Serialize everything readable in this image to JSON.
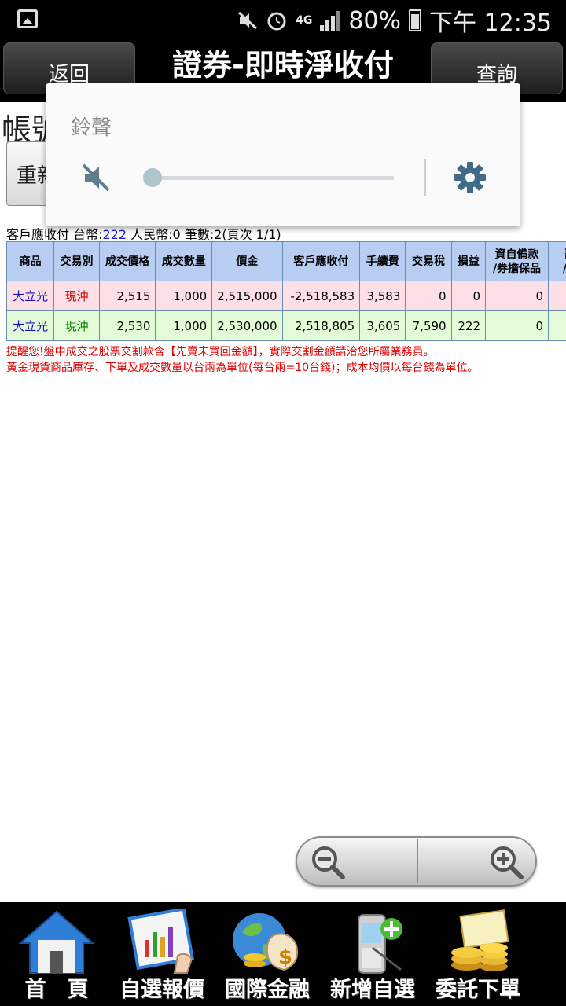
{
  "status_bar": {
    "network": "4G",
    "battery": "80%",
    "time": "下午 12:35"
  },
  "header": {
    "back_label": "返回",
    "title": "證券-即時淨收付",
    "query_label": "查詢"
  },
  "background": {
    "account_label": "帳號",
    "refresh_label": "重新"
  },
  "volume_popup": {
    "title": "鈴聲",
    "level": 0
  },
  "summary": {
    "prefix": "客戶應收付 台幣:",
    "twd": "222",
    "rmb_text": " 人民幣:0 筆數:2(頁次 1/1)"
  },
  "table": {
    "headers": [
      "商品",
      "交易別",
      "成交價格",
      "成交數量",
      "價金",
      "客戶應收付",
      "手續費",
      "交易稅",
      "損益",
      "資自備款\n/券擔保品",
      "融資\n/券保"
    ],
    "rows": [
      [
        "大立光",
        "現沖",
        "2,515",
        "1,000",
        "2,515,000",
        "-2,518,583",
        "3,583",
        "0",
        "0",
        "0",
        ""
      ],
      [
        "大立光",
        "現沖",
        "2,530",
        "1,000",
        "2,530,000",
        "2,518,805",
        "3,605",
        "7,590",
        "222",
        "0",
        ""
      ]
    ]
  },
  "notes": [
    "提醒您!盤中成交之股票交割款含【先賣未買回金額】，實際交割金額請洽您所屬業務員。",
    "黃金現貨商品庫存、下單及成交數量以台兩為單位(每台兩=10台錢)；成本均價以每台錢為單位。"
  ],
  "bottom_nav": [
    {
      "label": "首　頁",
      "icon": "home-icon"
    },
    {
      "label": "自選報價",
      "icon": "chart-icon"
    },
    {
      "label": "國際金融",
      "icon": "globe-money-icon"
    },
    {
      "label": "新增自選",
      "icon": "phone-add-icon"
    },
    {
      "label": "委託下單",
      "icon": "coins-icon"
    }
  ],
  "colors": {
    "header_bg": "#000000",
    "table_header": "#b7cdf2",
    "row_pink": "#fde0e6",
    "row_green": "#e3fbd6",
    "note_red": "#e00000"
  }
}
